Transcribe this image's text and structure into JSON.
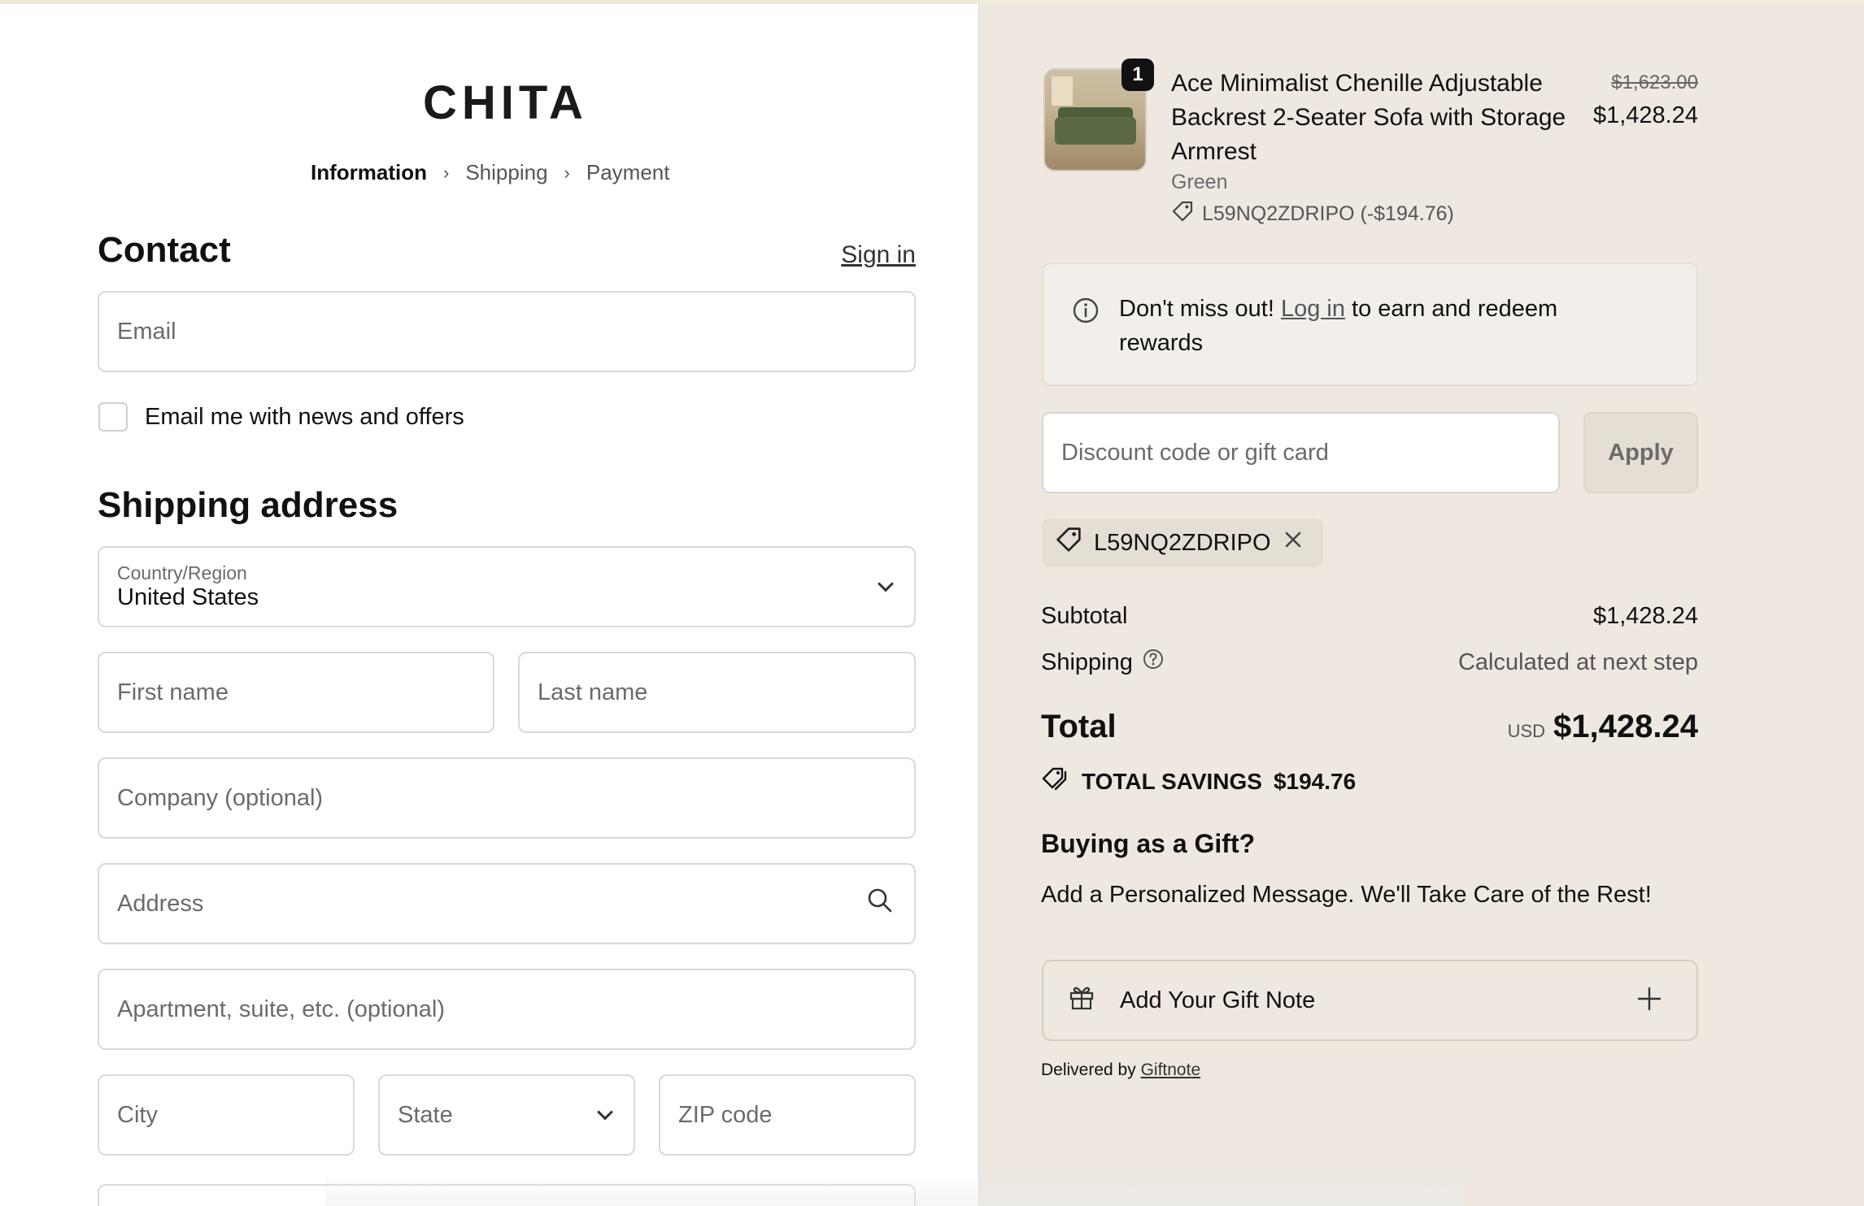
{
  "brand": {
    "logo": "CHITA"
  },
  "breadcrumb": {
    "items": [
      "Information",
      "Shipping",
      "Payment"
    ]
  },
  "contact": {
    "title": "Contact",
    "sign_in": "Sign in",
    "email_placeholder": "Email",
    "newsletter_label": "Email me with news and offers"
  },
  "shipping": {
    "title": "Shipping address",
    "country_label": "Country/Region",
    "country_value": "United States",
    "first_name": "First name",
    "last_name": "Last name",
    "company": "Company (optional)",
    "address": "Address",
    "apartment": "Apartment, suite, etc. (optional)",
    "city": "City",
    "state": "State",
    "zip": "ZIP code"
  },
  "cart": {
    "quantity_badge": "1",
    "product_name": "Ace Minimalist Chenille Adjustable Backrest 2-Seater Sofa with Storage Armrest",
    "variant": "Green",
    "discount_line": "L59NQ2ZDRIPO (-$194.76)",
    "price_original": "$1,623.00",
    "price_current": "$1,428.24"
  },
  "rewards": {
    "prefix": "Don't miss out!",
    "link": "Log in",
    "suffix": "to earn and redeem rewards"
  },
  "discount": {
    "placeholder": "Discount code or gift card",
    "apply_label": "Apply",
    "applied_code": "L59NQ2ZDRIPO"
  },
  "summary": {
    "subtotal_label": "Subtotal",
    "subtotal_value": "$1,428.24",
    "shipping_label": "Shipping",
    "shipping_value": "Calculated at next step",
    "total_label": "Total",
    "currency": "USD",
    "total_value": "$1,428.24",
    "savings_label": "TOTAL SAVINGS",
    "savings_value": "$194.76"
  },
  "gift": {
    "title": "Buying as a Gift?",
    "description": "Add a Personalized Message. We'll Take Care of the Rest!",
    "button_label": "Add Your Gift Note",
    "delivered_prefix": "Delivered by",
    "delivered_link": "Giftnote"
  },
  "colors": {
    "right_panel_bg": "#eee8e1",
    "field_border": "#d9d9d9"
  }
}
